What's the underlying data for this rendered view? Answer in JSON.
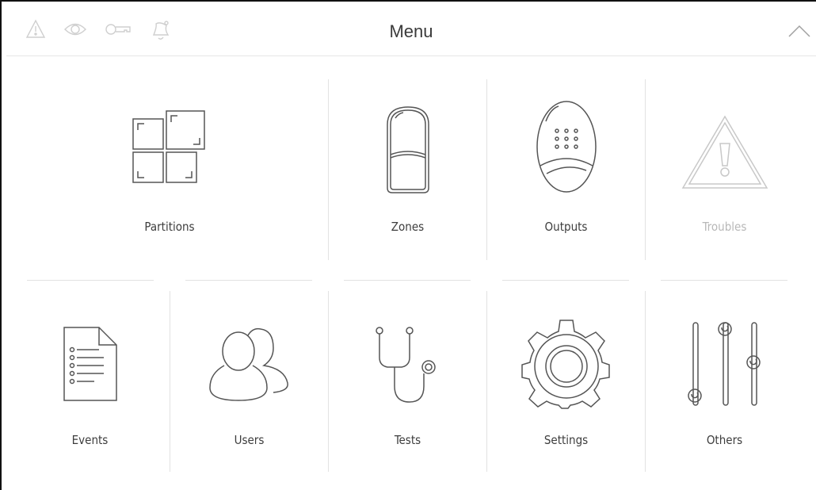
{
  "header": {
    "title": "Menu",
    "status_icons": [
      "trouble-indicator-icon",
      "view-icon",
      "service-key-icon",
      "alarm-bell-icon"
    ],
    "collapse_icon": "chevron-up-icon"
  },
  "menu": {
    "partitions": {
      "label": "Partitions",
      "icon": "partitions-grid-icon"
    },
    "zones": {
      "label": "Zones",
      "icon": "motion-detector-icon"
    },
    "outputs": {
      "label": "Outputs",
      "icon": "siren-icon"
    },
    "troubles": {
      "label": "Troubles",
      "icon": "warning-triangle-icon",
      "enabled": false
    },
    "events": {
      "label": "Events",
      "icon": "document-list-icon"
    },
    "users": {
      "label": "Users",
      "icon": "users-icon"
    },
    "tests": {
      "label": "Tests",
      "icon": "stethoscope-icon"
    },
    "settings": {
      "label": "Settings",
      "icon": "gear-icon"
    },
    "others": {
      "label": "Others",
      "icon": "sliders-icon"
    }
  },
  "colors": {
    "icon_stroke": "#555555",
    "disabled": "#c8c8c8",
    "divider": "#e2e2e2"
  }
}
